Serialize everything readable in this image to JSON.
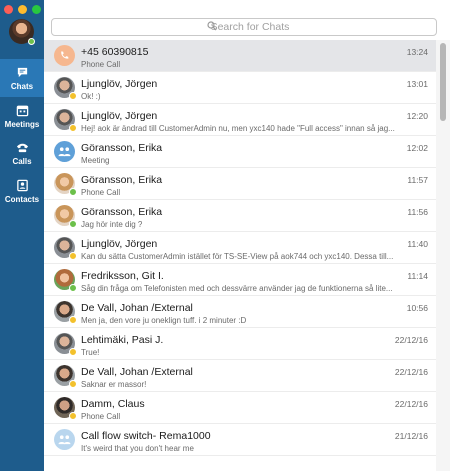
{
  "nav": {
    "chats": "Chats",
    "meetings": "Meetings",
    "calls": "Calls",
    "contacts": "Contacts"
  },
  "search": {
    "placeholder": "Search for Chats"
  },
  "colors": {
    "sidebar": "#1e5c8c",
    "active": "#2a78b6",
    "available": "#6cc04a",
    "away": "#f3c12c"
  },
  "chats": [
    {
      "name": "+45 60390815",
      "sub": "Phone Call",
      "time": "13:24",
      "avatar": "phone-icon",
      "presence": ""
    },
    {
      "name": "Ljunglöv, Jörgen",
      "sub": "Ok! :)",
      "time": "13:01",
      "avatar": "man",
      "presence": "away"
    },
    {
      "name": "Ljunglöv, Jörgen",
      "sub": "Hej!  aok är ändrad till CustomerAdmin nu, men yxc140 hade \"Full access\" innan så jag...",
      "time": "12:20",
      "avatar": "man",
      "presence": "away"
    },
    {
      "name": "Göransson, Erika",
      "sub": "Meeting",
      "time": "12:02",
      "avatar": "meeting-icon",
      "presence": ""
    },
    {
      "name": "Göransson, Erika",
      "sub": "Phone Call",
      "time": "11:57",
      "avatar": "woman",
      "presence": "available"
    },
    {
      "name": "Göransson, Erika",
      "sub": "Jag hör inte dig ?",
      "time": "11:56",
      "avatar": "woman",
      "presence": "available"
    },
    {
      "name": "Ljunglöv, Jörgen",
      "sub": "Kan du sätta CustomerAdmin istället för TS-SE-View på aok744 och yxc140. Dessa till...",
      "time": "11:40",
      "avatar": "man",
      "presence": "away"
    },
    {
      "name": "Fredriksson, Git I.",
      "sub": "Såg din fråga om Telefonisten med och dessvärre använder jag de funktionerna så lite...",
      "time": "11:14",
      "avatar": "woman2",
      "presence": "available"
    },
    {
      "name": "De Vall, Johan /External",
      "sub": "Men ja, den vore ju oneklign tuff. i 2 minuter :D",
      "time": "10:56",
      "avatar": "man2",
      "presence": "away"
    },
    {
      "name": "Lehtimäki, Pasi J.",
      "sub": "True!",
      "time": "22/12/16",
      "avatar": "man",
      "presence": "away"
    },
    {
      "name": "De Vall, Johan /External",
      "sub": "Saknar er massor!",
      "time": "22/12/16",
      "avatar": "man2",
      "presence": "away"
    },
    {
      "name": "Damm, Claus",
      "sub": "Phone Call",
      "time": "22/12/16",
      "avatar": "man3",
      "presence": "away"
    },
    {
      "name": "Call flow switch- Rema1000",
      "sub": "It's weird that you don't hear me",
      "time": "21/12/16",
      "avatar": "meeting-icon-faded",
      "presence": ""
    }
  ]
}
